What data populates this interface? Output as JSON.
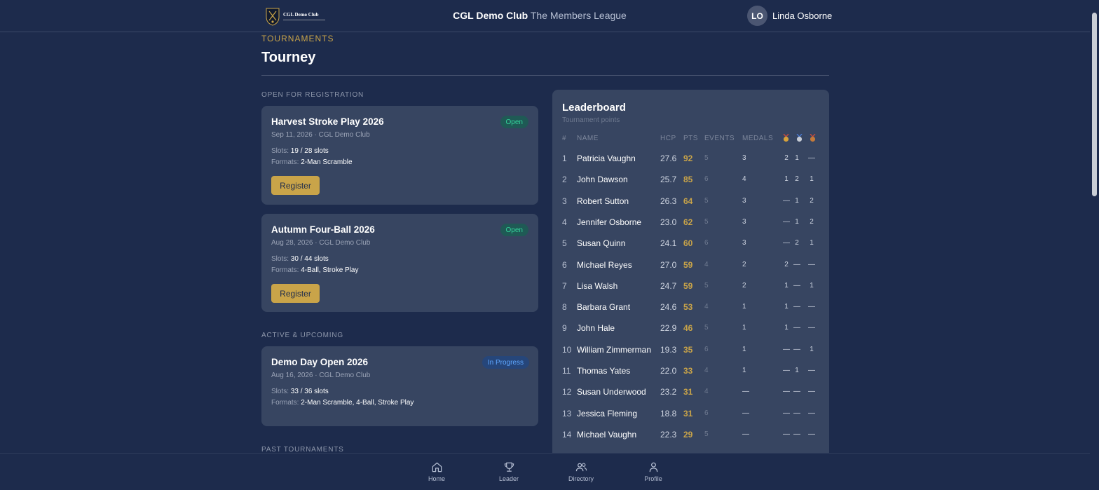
{
  "header": {
    "logo_text": "CGL Demo Club",
    "club_name": "CGL Demo Club",
    "league_name": "The Members League",
    "user_initials": "LO",
    "user_name": "Linda Osborne"
  },
  "page": {
    "breadcrumb": "TOURNAMENTS",
    "title": "Tourney"
  },
  "sections": {
    "open": "OPEN FOR REGISTRATION",
    "active": "ACTIVE & UPCOMING",
    "past": "PAST TOURNAMENTS"
  },
  "tournaments": [
    {
      "name": "Harvest Stroke Play 2026",
      "meta": "Sep 11, 2026 · CGL Demo Club",
      "status": "Open",
      "slots_label": "Slots: ",
      "slots": "19 / 28 slots",
      "formats_label": "Formats: ",
      "formats": "2-Man Scramble",
      "action": "Register"
    },
    {
      "name": "Autumn Four-Ball 2026",
      "meta": "Aug 28, 2026 · CGL Demo Club",
      "status": "Open",
      "slots_label": "Slots: ",
      "slots": "30 / 44 slots",
      "formats_label": "Formats: ",
      "formats": "4-Ball, Stroke Play",
      "action": "Register"
    },
    {
      "name": "Demo Day Open 2026",
      "meta": "Aug 16, 2026 · CGL Demo Club",
      "status": "In Progress",
      "slots_label": "Slots: ",
      "slots": "33 / 36 slots",
      "formats_label": "Formats: ",
      "formats": "2-Man Scramble, 4-Ball, Stroke Play"
    }
  ],
  "leaderboard": {
    "title": "Leaderboard",
    "subtitle": "Tournament points",
    "columns": {
      "rank": "#",
      "name": "NAME",
      "hcp": "HCP",
      "pts": "PTS",
      "events": "EVENTS",
      "medals": "MEDALS"
    },
    "medal_icons": [
      "gold-medal-icon",
      "silver-medal-icon",
      "bronze-medal-icon"
    ],
    "rows": [
      {
        "rank": "1",
        "name": "Patricia Vaughn",
        "hcp": "27.6",
        "pts": "92",
        "events": "5",
        "medals": "3",
        "gold": "2",
        "silver": "1",
        "bronze": "—"
      },
      {
        "rank": "2",
        "name": "John Dawson",
        "hcp": "25.7",
        "pts": "85",
        "events": "6",
        "medals": "4",
        "gold": "1",
        "silver": "2",
        "bronze": "1"
      },
      {
        "rank": "3",
        "name": "Robert Sutton",
        "hcp": "26.3",
        "pts": "64",
        "events": "5",
        "medals": "3",
        "gold": "—",
        "silver": "1",
        "bronze": "2"
      },
      {
        "rank": "4",
        "name": "Jennifer Osborne",
        "hcp": "23.0",
        "pts": "62",
        "events": "5",
        "medals": "3",
        "gold": "—",
        "silver": "1",
        "bronze": "2"
      },
      {
        "rank": "5",
        "name": "Susan Quinn",
        "hcp": "24.1",
        "pts": "60",
        "events": "6",
        "medals": "3",
        "gold": "—",
        "silver": "2",
        "bronze": "1"
      },
      {
        "rank": "6",
        "name": "Michael Reyes",
        "hcp": "27.0",
        "pts": "59",
        "events": "4",
        "medals": "2",
        "gold": "2",
        "silver": "—",
        "bronze": "—"
      },
      {
        "rank": "7",
        "name": "Lisa Walsh",
        "hcp": "24.7",
        "pts": "59",
        "events": "5",
        "medals": "2",
        "gold": "1",
        "silver": "—",
        "bronze": "1"
      },
      {
        "rank": "8",
        "name": "Barbara Grant",
        "hcp": "24.6",
        "pts": "53",
        "events": "4",
        "medals": "1",
        "gold": "1",
        "silver": "—",
        "bronze": "—"
      },
      {
        "rank": "9",
        "name": "John Hale",
        "hcp": "22.9",
        "pts": "46",
        "events": "5",
        "medals": "1",
        "gold": "1",
        "silver": "—",
        "bronze": "—"
      },
      {
        "rank": "10",
        "name": "William Zimmerman",
        "hcp": "19.3",
        "pts": "35",
        "events": "6",
        "medals": "1",
        "gold": "—",
        "silver": "—",
        "bronze": "1"
      },
      {
        "rank": "11",
        "name": "Thomas Yates",
        "hcp": "22.0",
        "pts": "33",
        "events": "4",
        "medals": "1",
        "gold": "—",
        "silver": "1",
        "bronze": "—"
      },
      {
        "rank": "12",
        "name": "Susan Underwood",
        "hcp": "23.2",
        "pts": "31",
        "events": "4",
        "medals": "—",
        "gold": "—",
        "silver": "—",
        "bronze": "—"
      },
      {
        "rank": "13",
        "name": "Jessica Fleming",
        "hcp": "18.8",
        "pts": "31",
        "events": "6",
        "medals": "—",
        "gold": "—",
        "silver": "—",
        "bronze": "—"
      },
      {
        "rank": "14",
        "name": "Michael Vaughn",
        "hcp": "22.3",
        "pts": "29",
        "events": "5",
        "medals": "—",
        "gold": "—",
        "silver": "—",
        "bronze": "—"
      }
    ]
  },
  "bottom_nav": [
    {
      "label": "Home",
      "icon": "home-icon"
    },
    {
      "label": "Leader",
      "icon": "trophy-icon"
    },
    {
      "label": "Directory",
      "icon": "people-icon"
    },
    {
      "label": "Profile",
      "icon": "person-icon"
    }
  ],
  "colors": {
    "background": "#1d2b4c",
    "card": "#374561",
    "accent_gold": "#c9a449",
    "open_badge": "#33d29a",
    "progress_badge": "#5ea7ff"
  }
}
